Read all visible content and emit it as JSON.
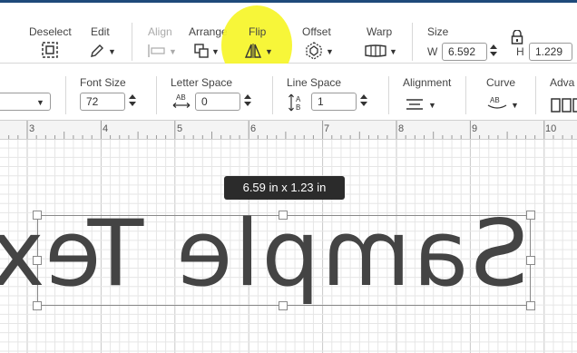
{
  "toolbar1": {
    "deselect": "Deselect",
    "edit": "Edit",
    "align": "Align",
    "arrange": "Arrange",
    "flip": "Flip",
    "offset": "Offset",
    "warp": "Warp",
    "size": "Size",
    "w_label": "W",
    "w_value": "6.592",
    "h_label": "H",
    "h_value": "1.229"
  },
  "toolbar2": {
    "font_select_value": "",
    "font_size_label": "Font Size",
    "font_size_value": "72",
    "letter_space_label": "Letter Space",
    "letter_space_value": "0",
    "line_space_label": "Line Space",
    "line_space_value": "1",
    "alignment_label": "Alignment",
    "curve_label": "Curve",
    "advanced_label": "Adva"
  },
  "ruler": {
    "ticks": [
      "3",
      "4",
      "5",
      "6",
      "7",
      "8",
      "9",
      "10"
    ]
  },
  "canvas": {
    "dimension_tooltip": "6.59  in x 1.23  in",
    "text": "Sample Text",
    "text_flipped": true
  },
  "colors": {
    "highlight": "#f6f52a",
    "text_fill": "#444444",
    "topbar": "#1e4a7a"
  },
  "icons": [
    "deselect-icon",
    "edit-pencil-icon",
    "align-icon",
    "arrange-icon",
    "flip-icon",
    "offset-icon",
    "warp-icon",
    "lock-icon",
    "letter-space-icon",
    "line-space-icon",
    "alignment-icon",
    "curve-icon",
    "advanced-icon"
  ]
}
